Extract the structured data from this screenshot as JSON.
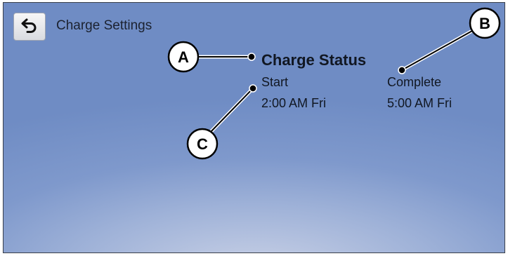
{
  "header": {
    "back_icon": "back-arrow-icon",
    "title": "Charge Settings"
  },
  "status": {
    "heading": "Charge Status",
    "start_label": "Start",
    "start_time": "2:00 AM Fri",
    "complete_label": "Complete",
    "complete_time": "5:00 AM Fri"
  },
  "callouts": {
    "a": "A",
    "b": "B",
    "c": "C"
  },
  "colors": {
    "background_top": "#6f8cc4",
    "background_bottom": "#c9d1e6",
    "text": "#111722"
  }
}
